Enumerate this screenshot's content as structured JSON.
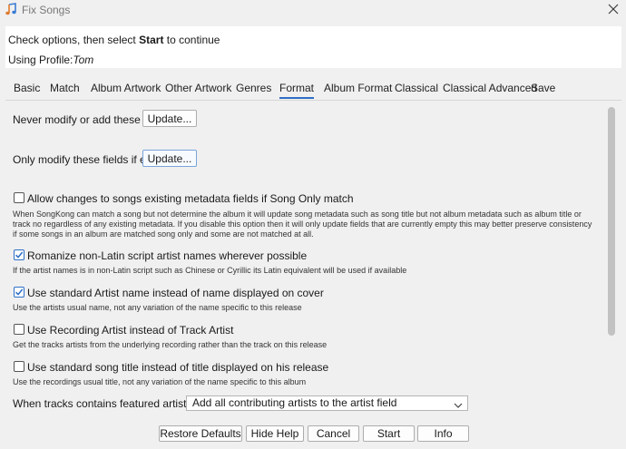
{
  "window": {
    "title": "Fix Songs"
  },
  "header": {
    "instruction_pre": "Check options, then select ",
    "instruction_bold": "Start",
    "instruction_post": " to continue",
    "profile_label": "Using Profile:",
    "profile_name": "Tom"
  },
  "tabs": [
    {
      "label": "Basic"
    },
    {
      "label": "Match"
    },
    {
      "label": "Album Artwork"
    },
    {
      "label": "Other Artwork"
    },
    {
      "label": "Genres"
    },
    {
      "label": "Format",
      "active": true
    },
    {
      "label": "Album Format"
    },
    {
      "label": "Classical"
    },
    {
      "label": "Classical Advanced"
    },
    {
      "label": "Save"
    }
  ],
  "fields": {
    "never_modify_label": "Never modify or add these fields:",
    "only_modify_label": "Only modify these fields if empty:",
    "update_label": "Update..."
  },
  "options": [
    {
      "label": "Allow changes to songs existing metadata fields if Song Only match",
      "checked": false,
      "help": "When SongKong can match a song but not determine the album it will update song metadata such as song title but not album metadata such as album title or track no regardless of any existing metadata. If you disable this option then it will only update fields that are currently empty this may better preserve consistency if some songs in an album are matched song only and some are not matched at all."
    },
    {
      "label": "Romanize non-Latin script artist names wherever possible",
      "checked": true,
      "help": "If the artist names is in non-Latin script such as Chinese or Cyrillic its Latin equivalent will be used if available"
    },
    {
      "label": "Use standard Artist name instead of name displayed on cover",
      "checked": true,
      "help": "Use the artists usual name, not any variation of the name specific to this release"
    },
    {
      "label": "Use Recording Artist instead of Track Artist",
      "checked": false,
      "help": "Get the tracks artists from the underlying recording rather than the track on this release"
    },
    {
      "label": "Use standard song title instead of title displayed on his release",
      "checked": false,
      "help": "Use the recordings usual title, not any variation of the name specific to this album"
    }
  ],
  "featured": {
    "label": "When tracks contains featured artists",
    "selected": "Add all contributing artists to the artist field"
  },
  "footer": {
    "restore_defaults": "Restore Defaults",
    "hide_help": "Hide Help",
    "cancel": "Cancel",
    "start": "Start",
    "info": "Info"
  },
  "colors": {
    "accent": "#2d6fc7",
    "background": "#f0f0f0"
  }
}
